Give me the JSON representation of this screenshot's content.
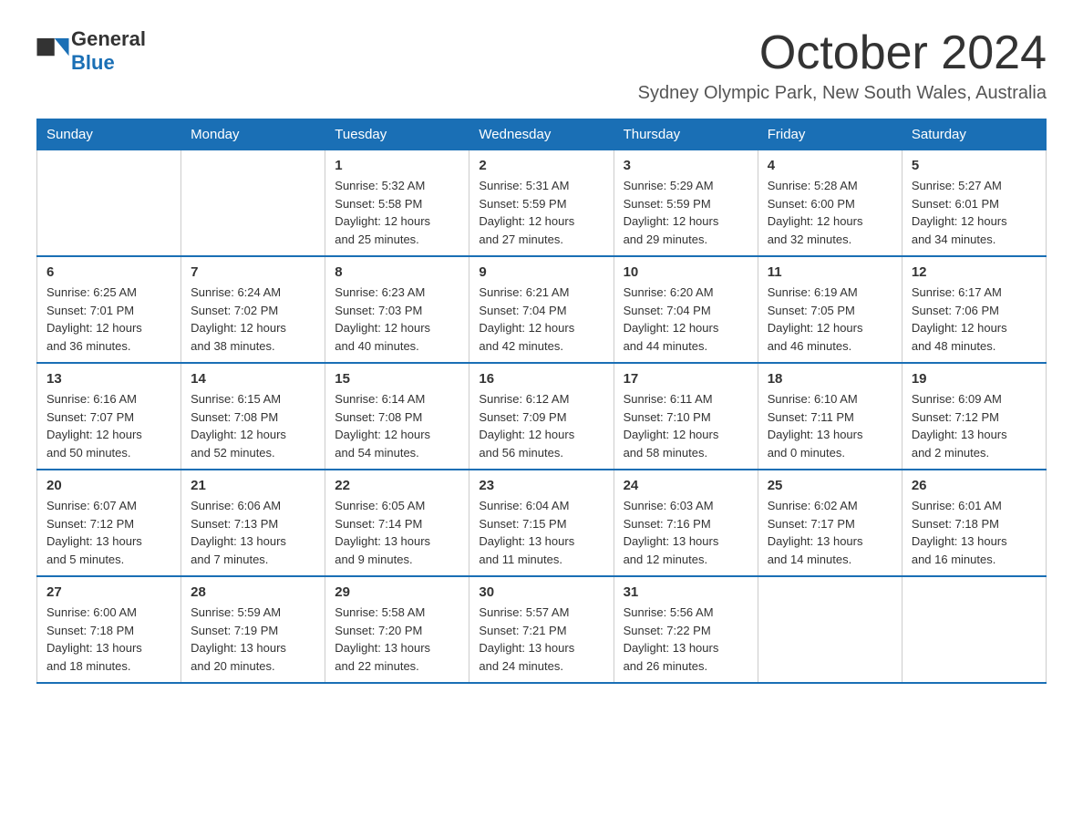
{
  "header": {
    "logo_text_general": "General",
    "logo_text_blue": "Blue",
    "month_title": "October 2024",
    "location": "Sydney Olympic Park, New South Wales, Australia"
  },
  "days_of_week": [
    "Sunday",
    "Monday",
    "Tuesday",
    "Wednesday",
    "Thursday",
    "Friday",
    "Saturday"
  ],
  "weeks": [
    [
      {
        "day": "",
        "info": ""
      },
      {
        "day": "",
        "info": ""
      },
      {
        "day": "1",
        "info": "Sunrise: 5:32 AM\nSunset: 5:58 PM\nDaylight: 12 hours\nand 25 minutes."
      },
      {
        "day": "2",
        "info": "Sunrise: 5:31 AM\nSunset: 5:59 PM\nDaylight: 12 hours\nand 27 minutes."
      },
      {
        "day": "3",
        "info": "Sunrise: 5:29 AM\nSunset: 5:59 PM\nDaylight: 12 hours\nand 29 minutes."
      },
      {
        "day": "4",
        "info": "Sunrise: 5:28 AM\nSunset: 6:00 PM\nDaylight: 12 hours\nand 32 minutes."
      },
      {
        "day": "5",
        "info": "Sunrise: 5:27 AM\nSunset: 6:01 PM\nDaylight: 12 hours\nand 34 minutes."
      }
    ],
    [
      {
        "day": "6",
        "info": "Sunrise: 6:25 AM\nSunset: 7:01 PM\nDaylight: 12 hours\nand 36 minutes."
      },
      {
        "day": "7",
        "info": "Sunrise: 6:24 AM\nSunset: 7:02 PM\nDaylight: 12 hours\nand 38 minutes."
      },
      {
        "day": "8",
        "info": "Sunrise: 6:23 AM\nSunset: 7:03 PM\nDaylight: 12 hours\nand 40 minutes."
      },
      {
        "day": "9",
        "info": "Sunrise: 6:21 AM\nSunset: 7:04 PM\nDaylight: 12 hours\nand 42 minutes."
      },
      {
        "day": "10",
        "info": "Sunrise: 6:20 AM\nSunset: 7:04 PM\nDaylight: 12 hours\nand 44 minutes."
      },
      {
        "day": "11",
        "info": "Sunrise: 6:19 AM\nSunset: 7:05 PM\nDaylight: 12 hours\nand 46 minutes."
      },
      {
        "day": "12",
        "info": "Sunrise: 6:17 AM\nSunset: 7:06 PM\nDaylight: 12 hours\nand 48 minutes."
      }
    ],
    [
      {
        "day": "13",
        "info": "Sunrise: 6:16 AM\nSunset: 7:07 PM\nDaylight: 12 hours\nand 50 minutes."
      },
      {
        "day": "14",
        "info": "Sunrise: 6:15 AM\nSunset: 7:08 PM\nDaylight: 12 hours\nand 52 minutes."
      },
      {
        "day": "15",
        "info": "Sunrise: 6:14 AM\nSunset: 7:08 PM\nDaylight: 12 hours\nand 54 minutes."
      },
      {
        "day": "16",
        "info": "Sunrise: 6:12 AM\nSunset: 7:09 PM\nDaylight: 12 hours\nand 56 minutes."
      },
      {
        "day": "17",
        "info": "Sunrise: 6:11 AM\nSunset: 7:10 PM\nDaylight: 12 hours\nand 58 minutes."
      },
      {
        "day": "18",
        "info": "Sunrise: 6:10 AM\nSunset: 7:11 PM\nDaylight: 13 hours\nand 0 minutes."
      },
      {
        "day": "19",
        "info": "Sunrise: 6:09 AM\nSunset: 7:12 PM\nDaylight: 13 hours\nand 2 minutes."
      }
    ],
    [
      {
        "day": "20",
        "info": "Sunrise: 6:07 AM\nSunset: 7:12 PM\nDaylight: 13 hours\nand 5 minutes."
      },
      {
        "day": "21",
        "info": "Sunrise: 6:06 AM\nSunset: 7:13 PM\nDaylight: 13 hours\nand 7 minutes."
      },
      {
        "day": "22",
        "info": "Sunrise: 6:05 AM\nSunset: 7:14 PM\nDaylight: 13 hours\nand 9 minutes."
      },
      {
        "day": "23",
        "info": "Sunrise: 6:04 AM\nSunset: 7:15 PM\nDaylight: 13 hours\nand 11 minutes."
      },
      {
        "day": "24",
        "info": "Sunrise: 6:03 AM\nSunset: 7:16 PM\nDaylight: 13 hours\nand 12 minutes."
      },
      {
        "day": "25",
        "info": "Sunrise: 6:02 AM\nSunset: 7:17 PM\nDaylight: 13 hours\nand 14 minutes."
      },
      {
        "day": "26",
        "info": "Sunrise: 6:01 AM\nSunset: 7:18 PM\nDaylight: 13 hours\nand 16 minutes."
      }
    ],
    [
      {
        "day": "27",
        "info": "Sunrise: 6:00 AM\nSunset: 7:18 PM\nDaylight: 13 hours\nand 18 minutes."
      },
      {
        "day": "28",
        "info": "Sunrise: 5:59 AM\nSunset: 7:19 PM\nDaylight: 13 hours\nand 20 minutes."
      },
      {
        "day": "29",
        "info": "Sunrise: 5:58 AM\nSunset: 7:20 PM\nDaylight: 13 hours\nand 22 minutes."
      },
      {
        "day": "30",
        "info": "Sunrise: 5:57 AM\nSunset: 7:21 PM\nDaylight: 13 hours\nand 24 minutes."
      },
      {
        "day": "31",
        "info": "Sunrise: 5:56 AM\nSunset: 7:22 PM\nDaylight: 13 hours\nand 26 minutes."
      },
      {
        "day": "",
        "info": ""
      },
      {
        "day": "",
        "info": ""
      }
    ]
  ]
}
